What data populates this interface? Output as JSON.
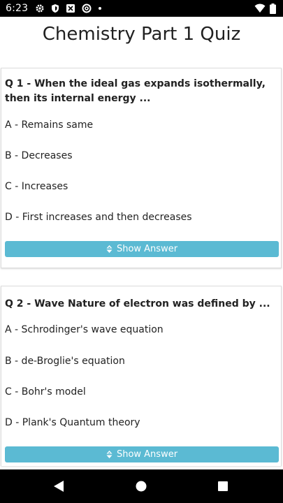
{
  "status_bar": {
    "time": "6:23",
    "icons": [
      "settings-icon",
      "shield-icon",
      "wifi-off-icon",
      "at-sign-icon",
      "dot-icon",
      "wifi-icon",
      "battery-icon"
    ]
  },
  "page": {
    "title": "Chemistry Part 1 Quiz"
  },
  "questions": [
    {
      "text": "Q 1 - When the ideal gas expands isothermally, then its internal energy ...",
      "options": [
        "A - Remains same",
        "B - Decreases",
        "C - Increases",
        "D - First increases and then decreases"
      ],
      "button_label": "Show Answer"
    },
    {
      "text": "Q 2 - Wave Nature of electron was defined by ...",
      "options": [
        "A - Schrodinger's wave equation",
        "B - de-Broglie's equation",
        "C - Bohr's model",
        "D - Plank's Quantum theory"
      ],
      "button_label": "Show Answer"
    }
  ],
  "nav_bar": {
    "icons": [
      "back-icon",
      "home-icon",
      "recents-icon"
    ]
  },
  "colors": {
    "button": "#5bbad3",
    "status_bar": "#000000",
    "nav_bar": "#000000"
  }
}
